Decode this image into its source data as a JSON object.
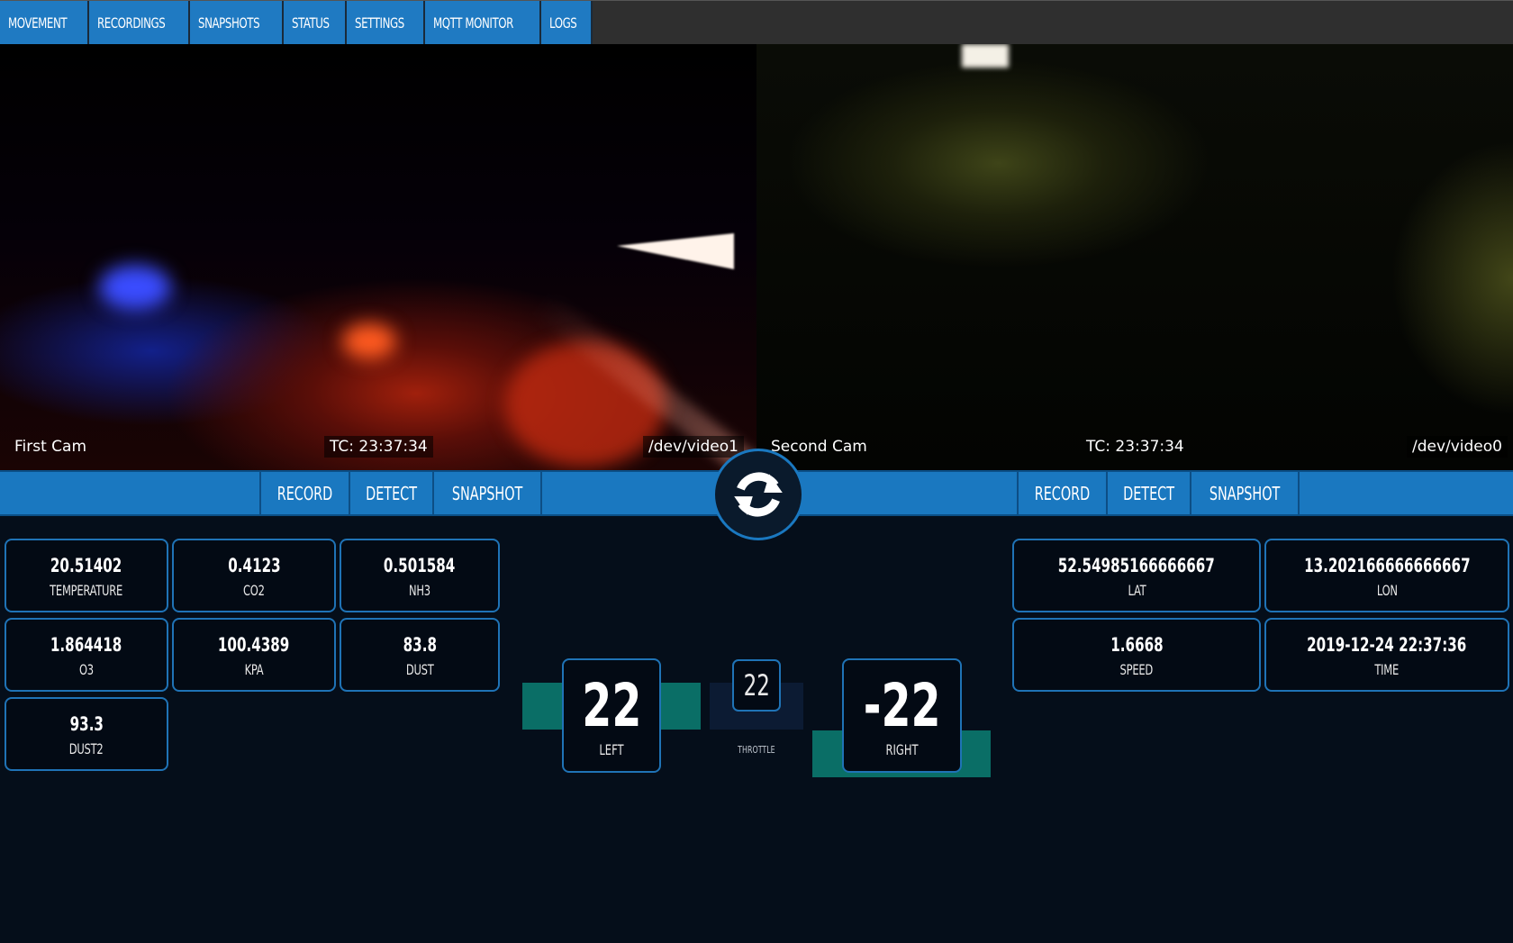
{
  "nav": {
    "tabs": [
      "MOVEMENT",
      "RECORDINGS",
      "SNAPSHOTS",
      "STATUS",
      "SETTINGS",
      "MQTT MONITOR",
      "LOGS"
    ]
  },
  "cameras": [
    {
      "name": "First Cam",
      "timecode": "TC: 23:37:34",
      "device": "/dev/video1"
    },
    {
      "name": "Second Cam",
      "timecode": "TC: 23:37:34",
      "device": "/dev/video0"
    }
  ],
  "controls": {
    "left": {
      "record": "RECORD",
      "detect": "DETECT",
      "snapshot": "SNAPSHOT"
    },
    "right": {
      "record": "RECORD",
      "detect": "DETECT",
      "snapshot": "SNAPSHOT"
    },
    "refresh_icon": "refresh-icon"
  },
  "sensors": [
    {
      "value": "20.51402",
      "label": "TEMPERATURE"
    },
    {
      "value": "0.4123",
      "label": "CO2"
    },
    {
      "value": "0.501584",
      "label": "NH3"
    },
    {
      "value": "1.864418",
      "label": "O3"
    },
    {
      "value": "100.4389",
      "label": "KPA"
    },
    {
      "value": "83.8",
      "label": "DUST"
    },
    {
      "value": "93.3",
      "label": "DUST2"
    }
  ],
  "gps": [
    {
      "value": "52.54985166666667",
      "label": "LAT"
    },
    {
      "value": "13.202166666666667",
      "label": "LON"
    },
    {
      "value": "1.6668",
      "label": "SPEED"
    },
    {
      "value": "2019-12-24 22:37:36",
      "label": "TIME"
    }
  ],
  "motors": {
    "left": {
      "value": "22",
      "label": "LEFT"
    },
    "right": {
      "value": "-22",
      "label": "RIGHT"
    },
    "throttle": {
      "value": "22",
      "label": "THROTTLE"
    }
  },
  "colors": {
    "accent": "#1a78c0",
    "background": "#050e1a",
    "motor_bar": "#0a6e66"
  }
}
